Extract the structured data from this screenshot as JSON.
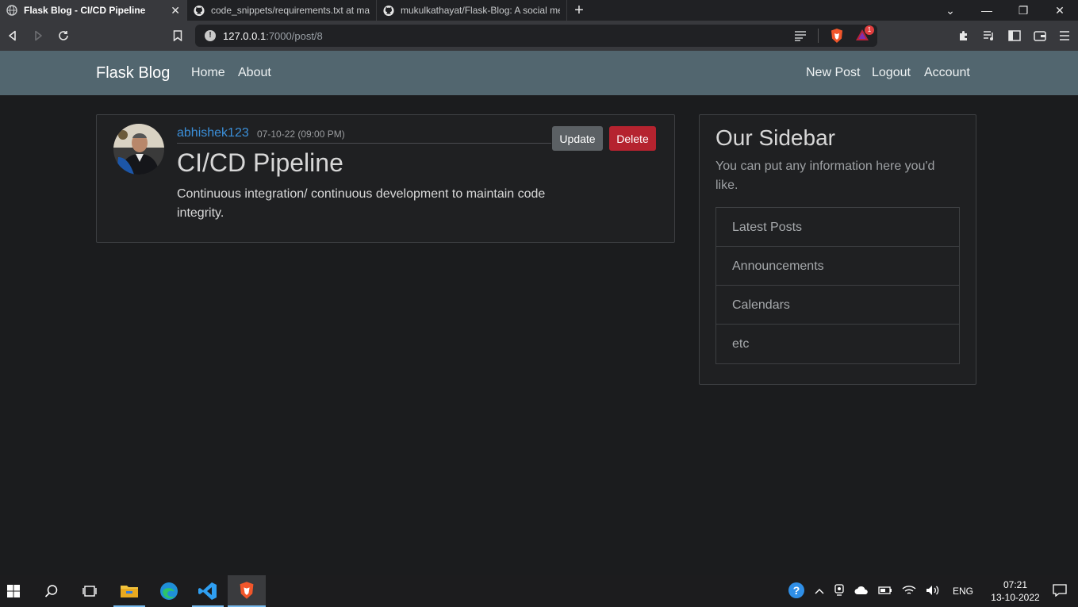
{
  "browser": {
    "tabs": [
      {
        "title": "Flask Blog - CI/CD Pipeline",
        "active": true
      },
      {
        "title": "code_snippets/requirements.txt at ma",
        "active": false
      },
      {
        "title": "mukulkathayat/Flask-Blog: A social me",
        "active": false
      }
    ],
    "new_tab_label": "+",
    "url_host": "127.0.0.1",
    "url_rest": ":7000/post/8",
    "brave_notification_count": "1"
  },
  "site": {
    "brand": "Flask Blog",
    "nav_left": [
      "Home",
      "About"
    ],
    "nav_right": [
      "New Post",
      "Logout",
      "Account"
    ]
  },
  "post": {
    "author": "abhishek123",
    "date": "07-10-22 (09:00 PM)",
    "update_label": "Update",
    "delete_label": "Delete",
    "title": "CI/CD Pipeline",
    "content": "Continuous integration/ continuous development to maintain code integrity."
  },
  "sidebar": {
    "title": "Our Sidebar",
    "text": "You can put any information here you'd like.",
    "items": [
      "Latest Posts",
      "Announcements",
      "Calendars",
      "etc"
    ]
  },
  "taskbar": {
    "language": "ENG",
    "time": "07:21",
    "date": "13-10-2022"
  },
  "colors": {
    "navbar": "#52666f",
    "page_bg": "#1b1c1e",
    "author_link": "#3b8fd9",
    "delete_button": "#b5232f",
    "update_button": "#5b6064"
  }
}
